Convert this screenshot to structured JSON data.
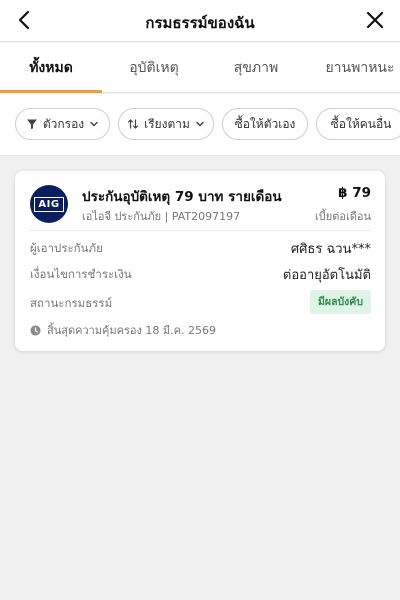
{
  "header": {
    "title": "กรมธรรม์ของฉัน"
  },
  "tabs": [
    {
      "label": "ทั้งหมด",
      "active": true
    },
    {
      "label": "อุบัติเหตุ",
      "active": false
    },
    {
      "label": "สุขภาพ",
      "active": false
    },
    {
      "label": "ยานพาหนะ",
      "active": false
    }
  ],
  "filters": {
    "filter_label": "ตัวกรอง",
    "sort_label": "เรียงตาม",
    "self_label": "ซื้อให้ตัวเอง",
    "others_label": "ซื้อให้คนอื่น"
  },
  "policy": {
    "logo_text": "AIG",
    "name": "ประกันอุบัติเหตุ 79 บาท รายเดือน",
    "insurer_line": "เอไอจี ประกันภัย | PAT2097197",
    "price": "฿ 79",
    "price_period": "เบี้ยต่อเดือน",
    "insured_label": "ผู้เอาประกันภัย",
    "insured_value": "ศศิธร ฉวน***",
    "payment_label": "เงื่อนไขการชำระเงิน",
    "payment_value": "ต่ออายุอัตโนมัติ",
    "status_label": "สถานะกรมธรรม์",
    "status_value": "มีผลบังคับ",
    "expiry_text": "สิ้นสุดความคุ้มครอง 18 มี.ค. 2569"
  },
  "colors": {
    "accent": "#f29b3a",
    "status_bg": "#dff3e6",
    "status_text": "#2f8a52",
    "logo_bg": "#0b1f5e"
  }
}
